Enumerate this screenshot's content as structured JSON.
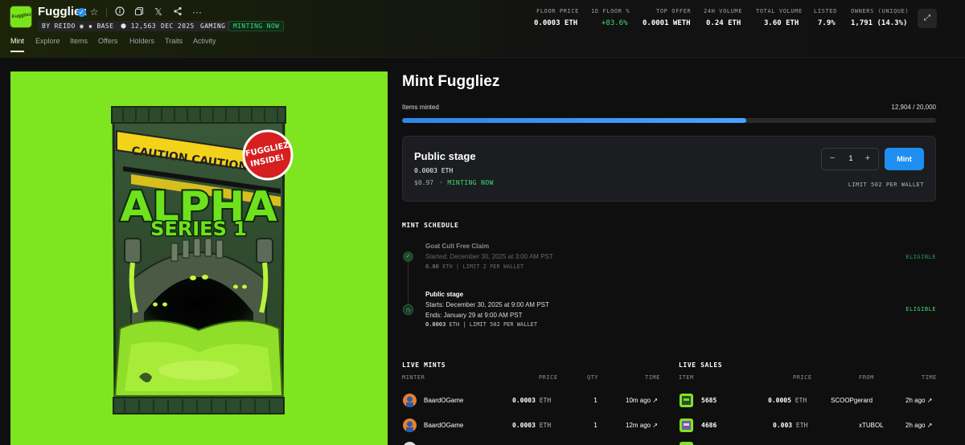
{
  "collection": {
    "name": "Fuggliez",
    "logo_text": "Fuggliez",
    "creator": "BY REIDO",
    "chain": "BASE",
    "item_count": "12,563",
    "date": "DEC 2025",
    "category": "GAMING",
    "status": "MINTING NOW"
  },
  "stats": [
    {
      "label": "FLOOR PRICE",
      "value": "0.0003 ETH"
    },
    {
      "label": "1D FLOOR %",
      "value": "+83.6%"
    },
    {
      "label": "TOP OFFER",
      "value": "0.0001 WETH"
    },
    {
      "label": "24H VOLUME",
      "value": "0.24 ETH"
    },
    {
      "label": "TOTAL VOLUME",
      "value": "3.60 ETH"
    },
    {
      "label": "LISTED",
      "value": "7.9%"
    },
    {
      "label": "OWNERS (UNIQUE)",
      "value": "1,791 (14.3%)"
    }
  ],
  "nav": [
    "Mint",
    "Explore",
    "Items",
    "Offers",
    "Holders",
    "Traits",
    "Activity"
  ],
  "artwork": {
    "caution": "CAUTION  CAUTION",
    "badge_line1": "FUGGLIEZ",
    "badge_line2": "INSIDE!",
    "headline": "ALPHA",
    "subline": "SERIES 1"
  },
  "mint": {
    "title": "Mint Fuggliez",
    "items_minted_label": "Items minted",
    "items_minted_value": "12,904 / 20,000",
    "progress_fraction": 0.645,
    "stage": {
      "title": "Public stage",
      "price": "0.0003 ETH",
      "usd": "$0.97",
      "live": "◦ MINTING NOW",
      "qty": "1",
      "minus": "−",
      "plus": "+",
      "button": "Mint",
      "limit": "LIMIT 502 PER WALLET"
    }
  },
  "schedule": {
    "heading": "MINT SCHEDULE",
    "items": [
      {
        "name": "Goat Cult Free Claim",
        "line1": "Started: December 30, 2025 at 3:00 AM PST",
        "line2": "",
        "meta_value": "0.00",
        "meta_rest": " ETH | LIMIT 2 PER WALLET",
        "status": "ELIGIBLE"
      },
      {
        "name": "Public stage",
        "line1": "Starts: December 30, 2025 at 9:00 AM PST",
        "line2": "Ends: January 29 at 9:00 AM PST",
        "meta_value": "0.0003",
        "meta_rest": " ETH | LIMIT 502 PER WALLET",
        "status": "ELIGIBLE"
      }
    ]
  },
  "live_mints": {
    "heading": "LIVE MINTS",
    "columns": [
      "MINTER",
      "PRICE",
      "QTY",
      "TIME"
    ],
    "rows": [
      {
        "minter": "BaardOGame",
        "price": "0.0003",
        "unit": "ETH",
        "qty": "1",
        "time": "10m ago ↗"
      },
      {
        "minter": "BaardOGame",
        "price": "0.0003",
        "unit": "ETH",
        "qty": "1",
        "time": "12m ago ↗"
      }
    ]
  },
  "live_sales": {
    "heading": "LIVE SALES",
    "columns": [
      "ITEM",
      "PRICE",
      "FROM",
      "TIME"
    ],
    "rows": [
      {
        "item": "5685",
        "price": "0.0005",
        "unit": "ETH",
        "from": "SCOOPgerard",
        "time": "2h ago ↗"
      },
      {
        "item": "4686",
        "price": "0.003",
        "unit": "ETH",
        "from": "xTUBOL",
        "time": "2h ago ↗"
      }
    ]
  },
  "colors": {
    "accent_blue": "#1e8ef0",
    "success_green": "#3ddc73",
    "art_bg": "#7ee520"
  }
}
